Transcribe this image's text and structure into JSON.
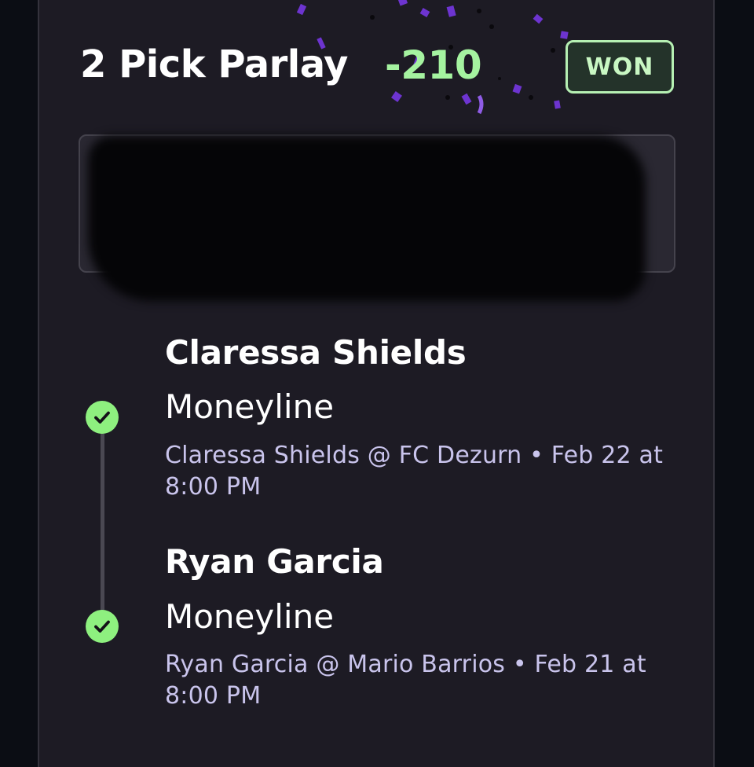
{
  "bet": {
    "title": "2 Pick Parlay",
    "odds": "-210",
    "status": "WON"
  },
  "legs": [
    {
      "name": "Claressa Shields",
      "market": "Moneyline",
      "detail": "Claressa Shields @ FC Dezurn  •  Feb 22 at 8:00 PM"
    },
    {
      "name": "Ryan Garcia",
      "market": "Moneyline",
      "detail": "Ryan Garcia @ Mario Barrios  •  Feb 21 at 8:00 PM"
    }
  ],
  "colors": {
    "background": "#1d1b24",
    "odds": "#a5f3a0",
    "won_badge": "#b6f0b3",
    "check": "#8ef07f",
    "confetti": "#7b3fd6",
    "detail_text": "#c9c4ec"
  },
  "icons": {
    "leg_status": "checkmark-circle-icon"
  }
}
